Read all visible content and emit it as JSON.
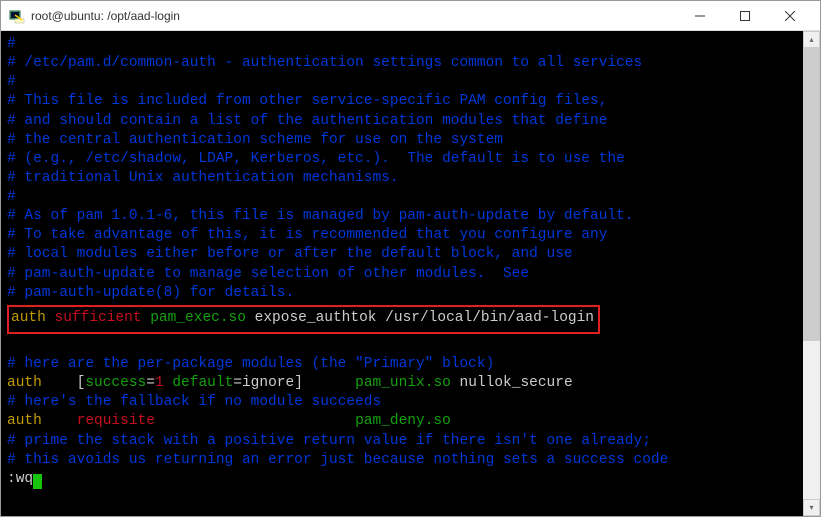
{
  "window": {
    "title": "root@ubuntu: /opt/aad-login",
    "icon_name": "putty-icon"
  },
  "lines": {
    "l1": "#",
    "l2": "# /etc/pam.d/common-auth - authentication settings common to all services",
    "l3": "#",
    "l4": "# This file is included from other service-specific PAM config files,",
    "l5": "# and should contain a list of the authentication modules that define",
    "l6": "# the central authentication scheme for use on the system",
    "l7": "# (e.g., /etc/shadow, LDAP, Kerberos, etc.).  The default is to use the",
    "l8": "# traditional Unix authentication mechanisms.",
    "l9": "#",
    "l10": "# As of pam 1.0.1-6, this file is managed by pam-auth-update by default.",
    "l11": "# To take advantage of this, it is recommended that you configure any",
    "l12": "# local modules either before or after the default block, and use",
    "l13": "# pam-auth-update to manage selection of other modules.  See",
    "l14": "# pam-auth-update(8) for details.",
    "hl_auth": "auth",
    "hl_sufficient": " sufficient",
    "hl_pamexec": " pam_exec.so",
    "hl_rest": " expose_authtok /usr/local/bin/aad-login",
    "l16": "# here are the per-package modules (the \"Primary\" block)",
    "l17_auth": "auth",
    "l17_gap1": "    ",
    "l17_bracket_open": "[",
    "l17_success": "success",
    "l17_eq1": "=",
    "l17_one": "1",
    "l17_default": " default",
    "l17_eq2": "=",
    "l17_ignore": "ignore",
    "l17_bracket_close": "]",
    "l17_gap2": "      ",
    "l17_pamunix": "pam_unix.so",
    "l17_nullok": " nullok_secure",
    "l18": "# here's the fallback if no module succeeds",
    "l19_auth": "auth",
    "l19_gap1": "    ",
    "l19_requisite": "requisite",
    "l19_gap2": "                       ",
    "l19_pamdeny": "pam_deny.so",
    "l20": "# prime the stack with a positive return value if there isn't one already;",
    "l21": "# this avoids us returning an error just because nothing sets a success code",
    "status": ":wq"
  }
}
